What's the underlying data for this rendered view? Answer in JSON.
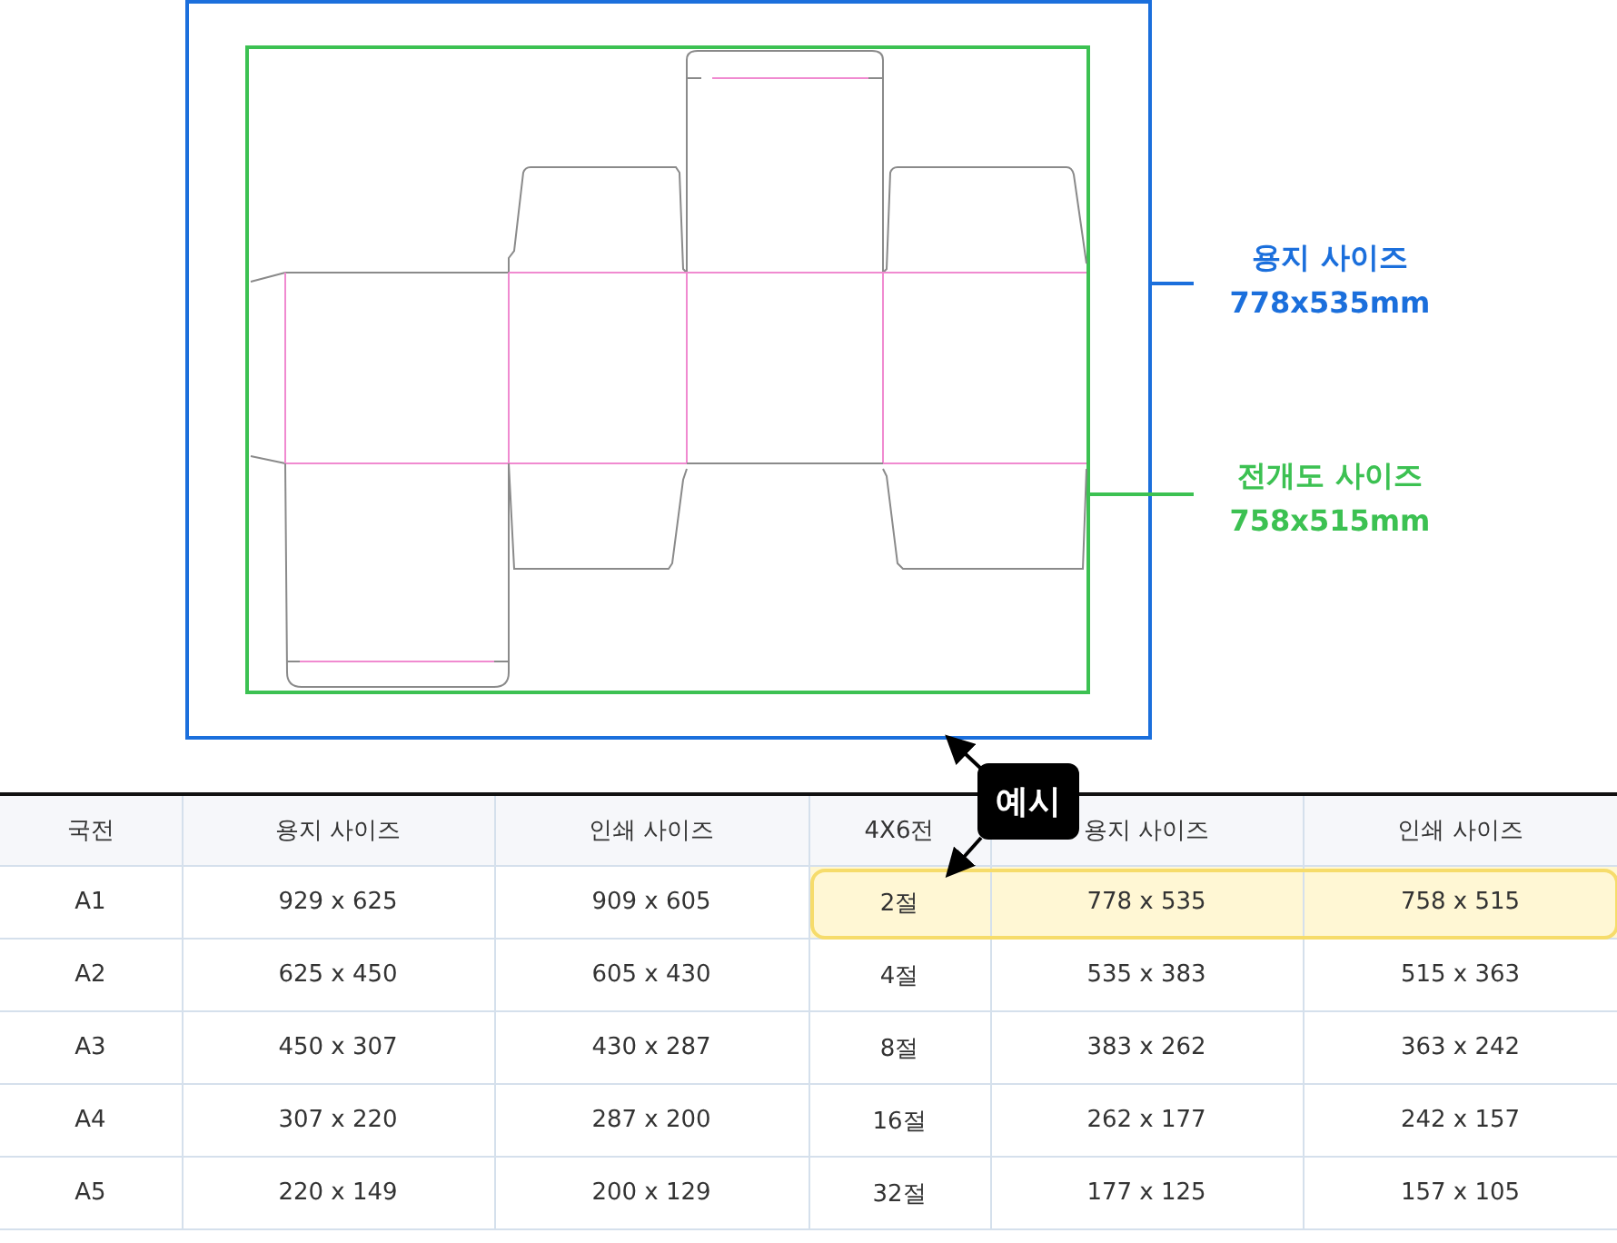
{
  "figure": {
    "labels": [
      {
        "kind": "paper",
        "title": "용지 사이즈",
        "size": "778x535mm"
      },
      {
        "kind": "dieline",
        "title": "전개도 사이즈",
        "size": "758x515mm"
      }
    ]
  },
  "badge": {
    "text": "예시"
  },
  "table": {
    "columns": [
      "국전",
      "용지 사이즈",
      "인쇄 사이즈",
      "4X6전",
      "용지 사이즈",
      "인쇄 사이즈"
    ],
    "rows": [
      {
        "cells": [
          "A1",
          "929 x 625",
          "909 x 605",
          "2절",
          "778 x 535",
          "758 x 515"
        ],
        "highlighted": true
      },
      {
        "cells": [
          "A2",
          "625 x 450",
          "605 x 430",
          "4절",
          "535 x 383",
          "515 x 363"
        ],
        "highlighted": false
      },
      {
        "cells": [
          "A3",
          "450 x 307",
          "430 x 287",
          "8절",
          "383 x 262",
          "363 x 242"
        ],
        "highlighted": false
      },
      {
        "cells": [
          "A4",
          "307 x 220",
          "287 x 200",
          "16절",
          "262 x 177",
          "242 x 157"
        ],
        "highlighted": false
      },
      {
        "cells": [
          "A5",
          "220 x 149",
          "200 x 129",
          "32절",
          "177 x 125",
          "157 x 105"
        ],
        "highlighted": false
      }
    ]
  }
}
